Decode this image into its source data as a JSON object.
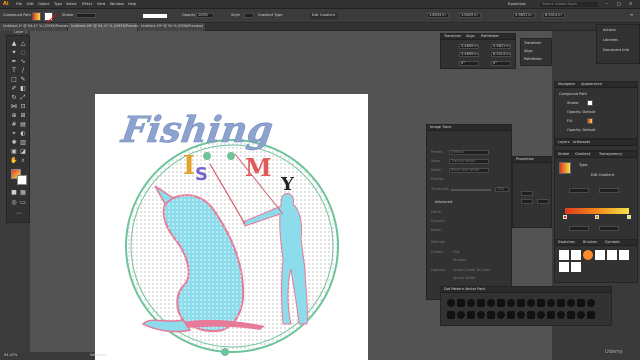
{
  "menu": {
    "logo": "Ai",
    "items": [
      "File",
      "Edit",
      "Object",
      "Type",
      "Select",
      "Effect",
      "View",
      "Window",
      "Help"
    ],
    "workspace": "Essentials",
    "search_placeholder": "Search Adobe Stock"
  },
  "control_bar": {
    "selection_type": "Compound Path",
    "stroke_label": "Stroke",
    "opacity_label": "Opacity",
    "opacity_value": "100%",
    "style_label": "Style",
    "gradient_type_label": "Gradient Type",
    "edit_gradient": "Edit Gradient",
    "x_value": "1.8034 in",
    "y_value": "1.6029 in",
    "w_value": "5.9831 in",
    "h_value": "6.5014 in"
  },
  "document_tabs": [
    {
      "label": "Untitled-1* @ 94.47 % (CMYK/Preview)"
    },
    {
      "label": "Untitled-18* @ 94.47 % (CMYK/Preview)",
      "active": true
    },
    {
      "label": "Untitled-19* @ 50 % (RGB/Preview)"
    }
  ],
  "layers_mini": {
    "tab1": "Layer 1",
    "tab2": "<Image>"
  },
  "transform_panel": {
    "tabs": [
      "Transform",
      "Align",
      "Pathfinder"
    ],
    "x": "3.4899 in",
    "y": "3.4899 in",
    "w": "5.9831 in",
    "h": "6.5014 in",
    "rot": "0°",
    "shear": "0°"
  },
  "mini_panels": [
    "Transform",
    "Align",
    "Pathfinder"
  ],
  "image_trace": {
    "title": "Image Trace",
    "preset_label": "Preset:",
    "preset": "Default",
    "view_label": "View:",
    "view": "Tracing Result",
    "mode_label": "Mode:",
    "mode": "Black and White",
    "palette_label": "Palette:",
    "threshold_label": "Threshold:",
    "threshold": "128",
    "advanced": "Advanced",
    "paths_label": "Paths:",
    "corners_label": "Corners:",
    "noise_label": "Noise:",
    "method_label": "Method:",
    "create_label": "Create:",
    "options_label": "Options:",
    "fills": "Fills",
    "strokes": "Strokes",
    "snap_curves": "Snap Curves To Lines",
    "ignore_white": "Ignore White",
    "trace": "Trace"
  },
  "properties_panel": {
    "title": "Properties"
  },
  "appearance_panel": {
    "tabs": [
      "Navigator",
      "Appearance"
    ],
    "object": "Compound Path",
    "stroke": "Stroke:",
    "fill": "Fill:",
    "opacity1": "Opacity: Default",
    "opacity2": "Opacity: Default"
  },
  "layers_panel": {
    "tabs": [
      "Layers",
      "Artboards"
    ]
  },
  "gradient_panel": {
    "tabs": [
      "Stroke",
      "Gradient",
      "Transparency"
    ],
    "type_label": "Type:",
    "edit_gradient": "Edit Gradient",
    "colors": [
      "#e03a20",
      "#f08a1a",
      "#f6e04a"
    ]
  },
  "swatches_panel": {
    "tabs": [
      "Swatches",
      "Brushes",
      "Symbols"
    ]
  },
  "brush_library": {
    "title": "Dot Pattern Vector Pack"
  },
  "right_dock": [
    "Actions",
    "Libraries",
    "Document Info"
  ],
  "artwork": {
    "title_word": "Fishing",
    "letters": [
      "I",
      "S",
      "M",
      "Y"
    ],
    "title_color": "#8da3cf",
    "fish_color": "#8ddcec",
    "fish_outline": "#e77a98",
    "circle_color": "#6dc49a"
  },
  "status": {
    "zoom": "94.47%",
    "tool": "Selection"
  },
  "watermark": "Udemy"
}
